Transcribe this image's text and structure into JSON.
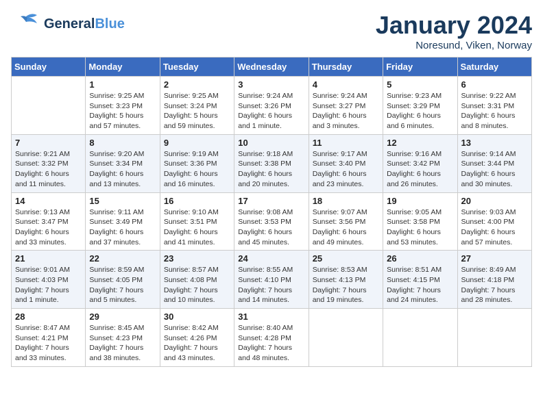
{
  "header": {
    "logo_general": "General",
    "logo_blue": "Blue",
    "month_title": "January 2024",
    "location": "Noresund, Viken, Norway"
  },
  "weekdays": [
    "Sunday",
    "Monday",
    "Tuesday",
    "Wednesday",
    "Thursday",
    "Friday",
    "Saturday"
  ],
  "weeks": [
    [
      {
        "day": "",
        "sunrise": "",
        "sunset": "",
        "daylight": ""
      },
      {
        "day": "1",
        "sunrise": "Sunrise: 9:25 AM",
        "sunset": "Sunset: 3:23 PM",
        "daylight": "Daylight: 5 hours and 57 minutes."
      },
      {
        "day": "2",
        "sunrise": "Sunrise: 9:25 AM",
        "sunset": "Sunset: 3:24 PM",
        "daylight": "Daylight: 5 hours and 59 minutes."
      },
      {
        "day": "3",
        "sunrise": "Sunrise: 9:24 AM",
        "sunset": "Sunset: 3:26 PM",
        "daylight": "Daylight: 6 hours and 1 minute."
      },
      {
        "day": "4",
        "sunrise": "Sunrise: 9:24 AM",
        "sunset": "Sunset: 3:27 PM",
        "daylight": "Daylight: 6 hours and 3 minutes."
      },
      {
        "day": "5",
        "sunrise": "Sunrise: 9:23 AM",
        "sunset": "Sunset: 3:29 PM",
        "daylight": "Daylight: 6 hours and 6 minutes."
      },
      {
        "day": "6",
        "sunrise": "Sunrise: 9:22 AM",
        "sunset": "Sunset: 3:31 PM",
        "daylight": "Daylight: 6 hours and 8 minutes."
      }
    ],
    [
      {
        "day": "7",
        "sunrise": "Sunrise: 9:21 AM",
        "sunset": "Sunset: 3:32 PM",
        "daylight": "Daylight: 6 hours and 11 minutes."
      },
      {
        "day": "8",
        "sunrise": "Sunrise: 9:20 AM",
        "sunset": "Sunset: 3:34 PM",
        "daylight": "Daylight: 6 hours and 13 minutes."
      },
      {
        "day": "9",
        "sunrise": "Sunrise: 9:19 AM",
        "sunset": "Sunset: 3:36 PM",
        "daylight": "Daylight: 6 hours and 16 minutes."
      },
      {
        "day": "10",
        "sunrise": "Sunrise: 9:18 AM",
        "sunset": "Sunset: 3:38 PM",
        "daylight": "Daylight: 6 hours and 20 minutes."
      },
      {
        "day": "11",
        "sunrise": "Sunrise: 9:17 AM",
        "sunset": "Sunset: 3:40 PM",
        "daylight": "Daylight: 6 hours and 23 minutes."
      },
      {
        "day": "12",
        "sunrise": "Sunrise: 9:16 AM",
        "sunset": "Sunset: 3:42 PM",
        "daylight": "Daylight: 6 hours and 26 minutes."
      },
      {
        "day": "13",
        "sunrise": "Sunrise: 9:14 AM",
        "sunset": "Sunset: 3:44 PM",
        "daylight": "Daylight: 6 hours and 30 minutes."
      }
    ],
    [
      {
        "day": "14",
        "sunrise": "Sunrise: 9:13 AM",
        "sunset": "Sunset: 3:47 PM",
        "daylight": "Daylight: 6 hours and 33 minutes."
      },
      {
        "day": "15",
        "sunrise": "Sunrise: 9:11 AM",
        "sunset": "Sunset: 3:49 PM",
        "daylight": "Daylight: 6 hours and 37 minutes."
      },
      {
        "day": "16",
        "sunrise": "Sunrise: 9:10 AM",
        "sunset": "Sunset: 3:51 PM",
        "daylight": "Daylight: 6 hours and 41 minutes."
      },
      {
        "day": "17",
        "sunrise": "Sunrise: 9:08 AM",
        "sunset": "Sunset: 3:53 PM",
        "daylight": "Daylight: 6 hours and 45 minutes."
      },
      {
        "day": "18",
        "sunrise": "Sunrise: 9:07 AM",
        "sunset": "Sunset: 3:56 PM",
        "daylight": "Daylight: 6 hours and 49 minutes."
      },
      {
        "day": "19",
        "sunrise": "Sunrise: 9:05 AM",
        "sunset": "Sunset: 3:58 PM",
        "daylight": "Daylight: 6 hours and 53 minutes."
      },
      {
        "day": "20",
        "sunrise": "Sunrise: 9:03 AM",
        "sunset": "Sunset: 4:00 PM",
        "daylight": "Daylight: 6 hours and 57 minutes."
      }
    ],
    [
      {
        "day": "21",
        "sunrise": "Sunrise: 9:01 AM",
        "sunset": "Sunset: 4:03 PM",
        "daylight": "Daylight: 7 hours and 1 minute."
      },
      {
        "day": "22",
        "sunrise": "Sunrise: 8:59 AM",
        "sunset": "Sunset: 4:05 PM",
        "daylight": "Daylight: 7 hours and 5 minutes."
      },
      {
        "day": "23",
        "sunrise": "Sunrise: 8:57 AM",
        "sunset": "Sunset: 4:08 PM",
        "daylight": "Daylight: 7 hours and 10 minutes."
      },
      {
        "day": "24",
        "sunrise": "Sunrise: 8:55 AM",
        "sunset": "Sunset: 4:10 PM",
        "daylight": "Daylight: 7 hours and 14 minutes."
      },
      {
        "day": "25",
        "sunrise": "Sunrise: 8:53 AM",
        "sunset": "Sunset: 4:13 PM",
        "daylight": "Daylight: 7 hours and 19 minutes."
      },
      {
        "day": "26",
        "sunrise": "Sunrise: 8:51 AM",
        "sunset": "Sunset: 4:15 PM",
        "daylight": "Daylight: 7 hours and 24 minutes."
      },
      {
        "day": "27",
        "sunrise": "Sunrise: 8:49 AM",
        "sunset": "Sunset: 4:18 PM",
        "daylight": "Daylight: 7 hours and 28 minutes."
      }
    ],
    [
      {
        "day": "28",
        "sunrise": "Sunrise: 8:47 AM",
        "sunset": "Sunset: 4:21 PM",
        "daylight": "Daylight: 7 hours and 33 minutes."
      },
      {
        "day": "29",
        "sunrise": "Sunrise: 8:45 AM",
        "sunset": "Sunset: 4:23 PM",
        "daylight": "Daylight: 7 hours and 38 minutes."
      },
      {
        "day": "30",
        "sunrise": "Sunrise: 8:42 AM",
        "sunset": "Sunset: 4:26 PM",
        "daylight": "Daylight: 7 hours and 43 minutes."
      },
      {
        "day": "31",
        "sunrise": "Sunrise: 8:40 AM",
        "sunset": "Sunset: 4:28 PM",
        "daylight": "Daylight: 7 hours and 48 minutes."
      },
      {
        "day": "",
        "sunrise": "",
        "sunset": "",
        "daylight": ""
      },
      {
        "day": "",
        "sunrise": "",
        "sunset": "",
        "daylight": ""
      },
      {
        "day": "",
        "sunrise": "",
        "sunset": "",
        "daylight": ""
      }
    ]
  ]
}
